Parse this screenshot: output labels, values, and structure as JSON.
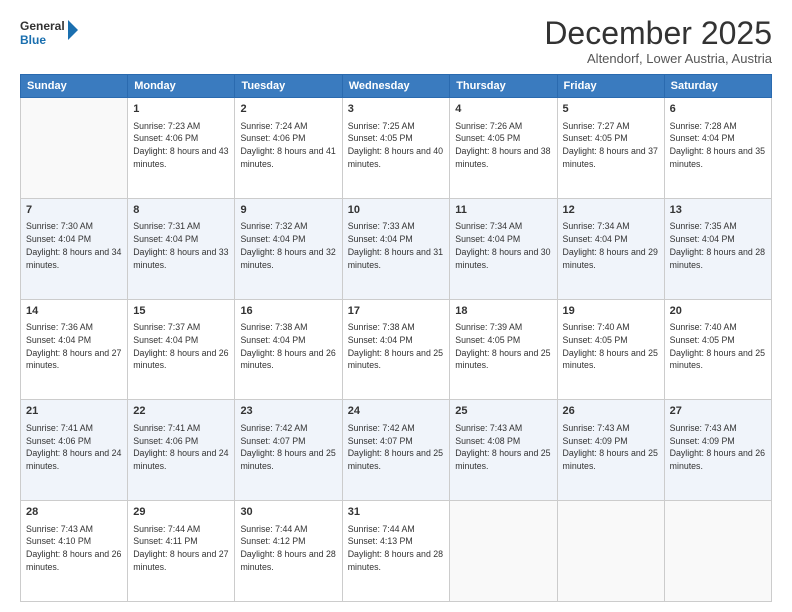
{
  "logo": {
    "line1": "General",
    "line2": "Blue"
  },
  "title": "December 2025",
  "subtitle": "Altendorf, Lower Austria, Austria",
  "weekdays": [
    "Sunday",
    "Monday",
    "Tuesday",
    "Wednesday",
    "Thursday",
    "Friday",
    "Saturday"
  ],
  "weeks": [
    [
      {
        "day": "",
        "sunrise": "",
        "sunset": "",
        "daylight": ""
      },
      {
        "day": "1",
        "sunrise": "Sunrise: 7:23 AM",
        "sunset": "Sunset: 4:06 PM",
        "daylight": "Daylight: 8 hours and 43 minutes."
      },
      {
        "day": "2",
        "sunrise": "Sunrise: 7:24 AM",
        "sunset": "Sunset: 4:06 PM",
        "daylight": "Daylight: 8 hours and 41 minutes."
      },
      {
        "day": "3",
        "sunrise": "Sunrise: 7:25 AM",
        "sunset": "Sunset: 4:05 PM",
        "daylight": "Daylight: 8 hours and 40 minutes."
      },
      {
        "day": "4",
        "sunrise": "Sunrise: 7:26 AM",
        "sunset": "Sunset: 4:05 PM",
        "daylight": "Daylight: 8 hours and 38 minutes."
      },
      {
        "day": "5",
        "sunrise": "Sunrise: 7:27 AM",
        "sunset": "Sunset: 4:05 PM",
        "daylight": "Daylight: 8 hours and 37 minutes."
      },
      {
        "day": "6",
        "sunrise": "Sunrise: 7:28 AM",
        "sunset": "Sunset: 4:04 PM",
        "daylight": "Daylight: 8 hours and 35 minutes."
      }
    ],
    [
      {
        "day": "7",
        "sunrise": "Sunrise: 7:30 AM",
        "sunset": "Sunset: 4:04 PM",
        "daylight": "Daylight: 8 hours and 34 minutes."
      },
      {
        "day": "8",
        "sunrise": "Sunrise: 7:31 AM",
        "sunset": "Sunset: 4:04 PM",
        "daylight": "Daylight: 8 hours and 33 minutes."
      },
      {
        "day": "9",
        "sunrise": "Sunrise: 7:32 AM",
        "sunset": "Sunset: 4:04 PM",
        "daylight": "Daylight: 8 hours and 32 minutes."
      },
      {
        "day": "10",
        "sunrise": "Sunrise: 7:33 AM",
        "sunset": "Sunset: 4:04 PM",
        "daylight": "Daylight: 8 hours and 31 minutes."
      },
      {
        "day": "11",
        "sunrise": "Sunrise: 7:34 AM",
        "sunset": "Sunset: 4:04 PM",
        "daylight": "Daylight: 8 hours and 30 minutes."
      },
      {
        "day": "12",
        "sunrise": "Sunrise: 7:34 AM",
        "sunset": "Sunset: 4:04 PM",
        "daylight": "Daylight: 8 hours and 29 minutes."
      },
      {
        "day": "13",
        "sunrise": "Sunrise: 7:35 AM",
        "sunset": "Sunset: 4:04 PM",
        "daylight": "Daylight: 8 hours and 28 minutes."
      }
    ],
    [
      {
        "day": "14",
        "sunrise": "Sunrise: 7:36 AM",
        "sunset": "Sunset: 4:04 PM",
        "daylight": "Daylight: 8 hours and 27 minutes."
      },
      {
        "day": "15",
        "sunrise": "Sunrise: 7:37 AM",
        "sunset": "Sunset: 4:04 PM",
        "daylight": "Daylight: 8 hours and 26 minutes."
      },
      {
        "day": "16",
        "sunrise": "Sunrise: 7:38 AM",
        "sunset": "Sunset: 4:04 PM",
        "daylight": "Daylight: 8 hours and 26 minutes."
      },
      {
        "day": "17",
        "sunrise": "Sunrise: 7:38 AM",
        "sunset": "Sunset: 4:04 PM",
        "daylight": "Daylight: 8 hours and 25 minutes."
      },
      {
        "day": "18",
        "sunrise": "Sunrise: 7:39 AM",
        "sunset": "Sunset: 4:05 PM",
        "daylight": "Daylight: 8 hours and 25 minutes."
      },
      {
        "day": "19",
        "sunrise": "Sunrise: 7:40 AM",
        "sunset": "Sunset: 4:05 PM",
        "daylight": "Daylight: 8 hours and 25 minutes."
      },
      {
        "day": "20",
        "sunrise": "Sunrise: 7:40 AM",
        "sunset": "Sunset: 4:05 PM",
        "daylight": "Daylight: 8 hours and 25 minutes."
      }
    ],
    [
      {
        "day": "21",
        "sunrise": "Sunrise: 7:41 AM",
        "sunset": "Sunset: 4:06 PM",
        "daylight": "Daylight: 8 hours and 24 minutes."
      },
      {
        "day": "22",
        "sunrise": "Sunrise: 7:41 AM",
        "sunset": "Sunset: 4:06 PM",
        "daylight": "Daylight: 8 hours and 24 minutes."
      },
      {
        "day": "23",
        "sunrise": "Sunrise: 7:42 AM",
        "sunset": "Sunset: 4:07 PM",
        "daylight": "Daylight: 8 hours and 25 minutes."
      },
      {
        "day": "24",
        "sunrise": "Sunrise: 7:42 AM",
        "sunset": "Sunset: 4:07 PM",
        "daylight": "Daylight: 8 hours and 25 minutes."
      },
      {
        "day": "25",
        "sunrise": "Sunrise: 7:43 AM",
        "sunset": "Sunset: 4:08 PM",
        "daylight": "Daylight: 8 hours and 25 minutes."
      },
      {
        "day": "26",
        "sunrise": "Sunrise: 7:43 AM",
        "sunset": "Sunset: 4:09 PM",
        "daylight": "Daylight: 8 hours and 25 minutes."
      },
      {
        "day": "27",
        "sunrise": "Sunrise: 7:43 AM",
        "sunset": "Sunset: 4:09 PM",
        "daylight": "Daylight: 8 hours and 26 minutes."
      }
    ],
    [
      {
        "day": "28",
        "sunrise": "Sunrise: 7:43 AM",
        "sunset": "Sunset: 4:10 PM",
        "daylight": "Daylight: 8 hours and 26 minutes."
      },
      {
        "day": "29",
        "sunrise": "Sunrise: 7:44 AM",
        "sunset": "Sunset: 4:11 PM",
        "daylight": "Daylight: 8 hours and 27 minutes."
      },
      {
        "day": "30",
        "sunrise": "Sunrise: 7:44 AM",
        "sunset": "Sunset: 4:12 PM",
        "daylight": "Daylight: 8 hours and 28 minutes."
      },
      {
        "day": "31",
        "sunrise": "Sunrise: 7:44 AM",
        "sunset": "Sunset: 4:13 PM",
        "daylight": "Daylight: 8 hours and 28 minutes."
      },
      {
        "day": "",
        "sunrise": "",
        "sunset": "",
        "daylight": ""
      },
      {
        "day": "",
        "sunrise": "",
        "sunset": "",
        "daylight": ""
      },
      {
        "day": "",
        "sunrise": "",
        "sunset": "",
        "daylight": ""
      }
    ]
  ]
}
